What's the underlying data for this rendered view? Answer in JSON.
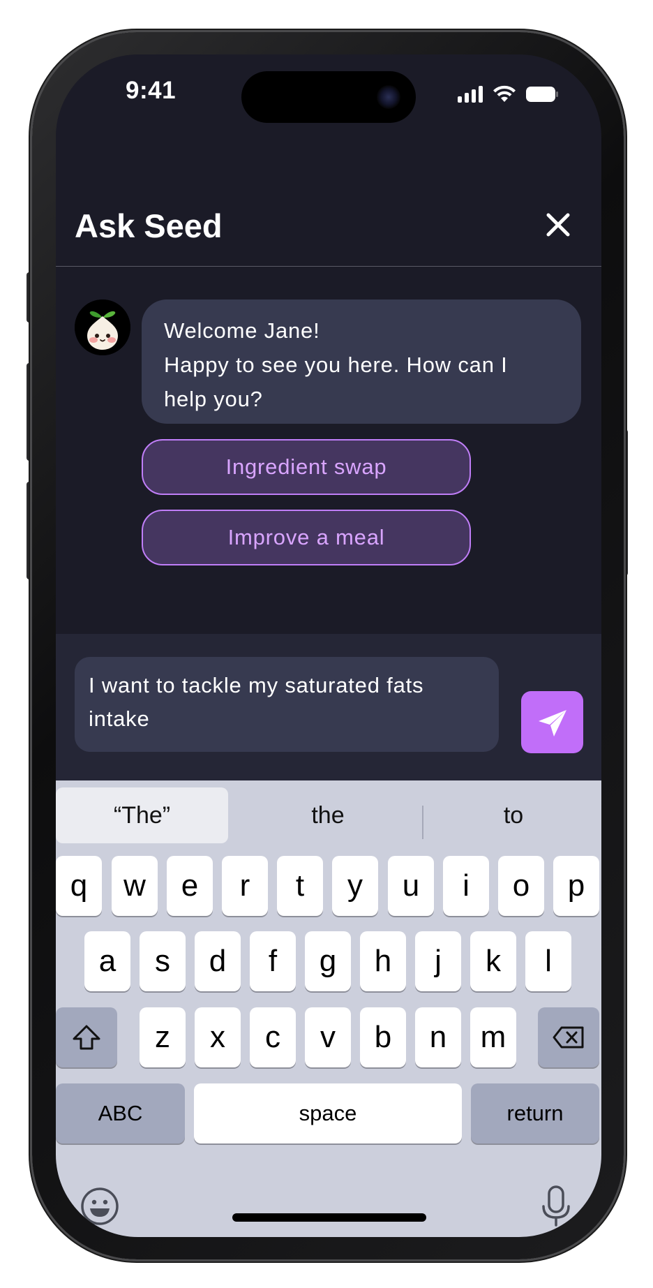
{
  "status_bar": {
    "time": "9:41"
  },
  "header": {
    "title": "Ask Seed",
    "close_icon": "close-icon"
  },
  "chat": {
    "bot_message_lines": [
      "Welcome Jane!",
      "Happy to see you here. How can I",
      "help you?"
    ],
    "suggestions": [
      "Ingredient swap",
      "Improve a meal"
    ]
  },
  "composer": {
    "input_lines": [
      "I want to tackle my saturated fats",
      "intake"
    ],
    "send_icon": "send-icon"
  },
  "keyboard": {
    "predictions": [
      "“The”",
      "the",
      "to"
    ],
    "row1": [
      "q",
      "w",
      "e",
      "r",
      "t",
      "y",
      "u",
      "i",
      "o",
      "p"
    ],
    "row2": [
      "a",
      "s",
      "d",
      "f",
      "g",
      "h",
      "j",
      "k",
      "l"
    ],
    "row3": [
      "z",
      "x",
      "c",
      "v",
      "b",
      "n",
      "m"
    ],
    "abc_label": "ABC",
    "space_label": "space",
    "return_label": "return"
  },
  "colors": {
    "screen_background": "#1b1b27",
    "bubble": "#373a50",
    "accent": "#c16ef9",
    "suggestion_fill": "#453660",
    "keyboard": "#cccfdc"
  }
}
